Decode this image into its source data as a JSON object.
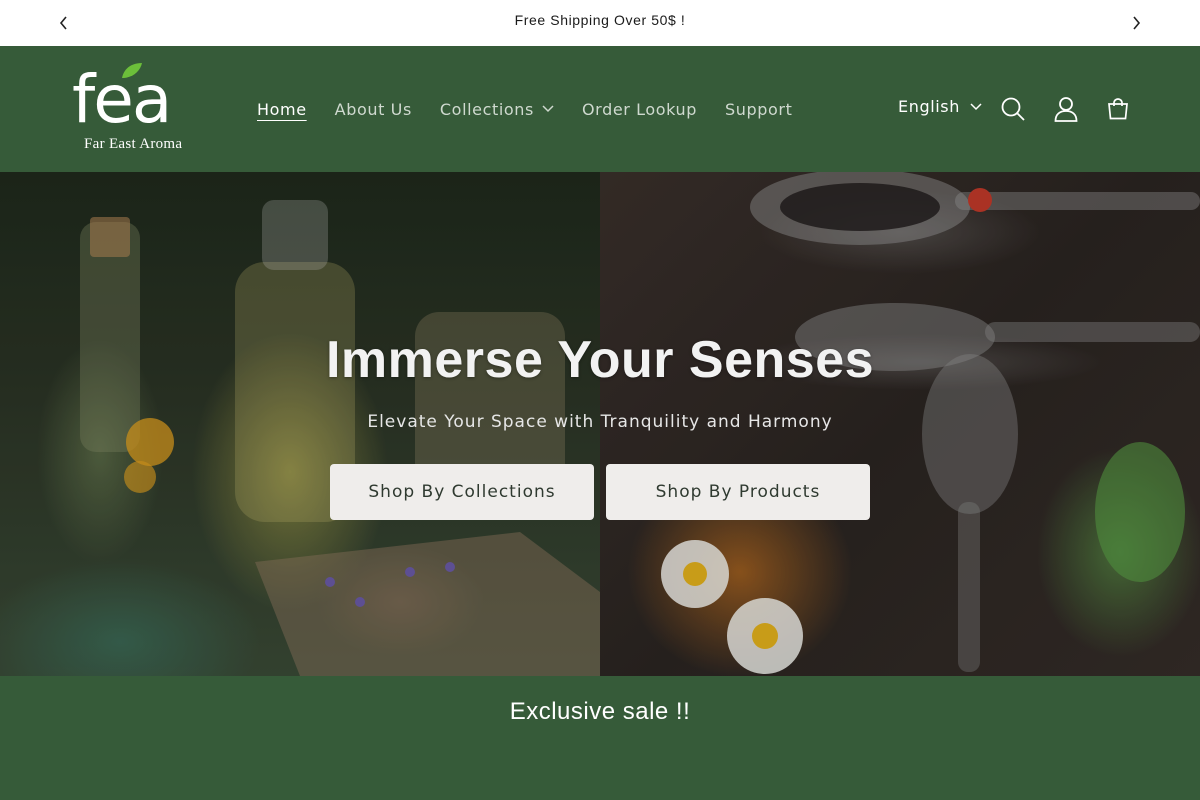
{
  "announcement": {
    "message": "Free Shipping Over 50$ !",
    "prev_icon": "chevron-left-icon",
    "next_icon": "chevron-right-icon"
  },
  "header": {
    "logo": {
      "wordmark": "fea",
      "tagline": "Far East Aroma"
    },
    "nav": [
      {
        "label": "Home",
        "active": true
      },
      {
        "label": "About Us",
        "active": false
      },
      {
        "label": "Collections",
        "active": false,
        "has_dropdown": true
      },
      {
        "label": "Order Lookup",
        "active": false
      },
      {
        "label": "Support",
        "active": false
      }
    ],
    "language": "English",
    "icons": [
      "search-icon",
      "account-icon",
      "cart-icon"
    ]
  },
  "hero": {
    "title": "Immerse Your Senses",
    "subtitle": "Elevate Your Space with Tranquility and Harmony",
    "buttons": [
      "Shop By Collections",
      "Shop By Products"
    ]
  },
  "sale": {
    "title": "Exclusive sale !!"
  },
  "colors": {
    "brand_green": "#365b39",
    "button_bg": "#efedeb",
    "leaf_green": "#6cbf3a"
  }
}
